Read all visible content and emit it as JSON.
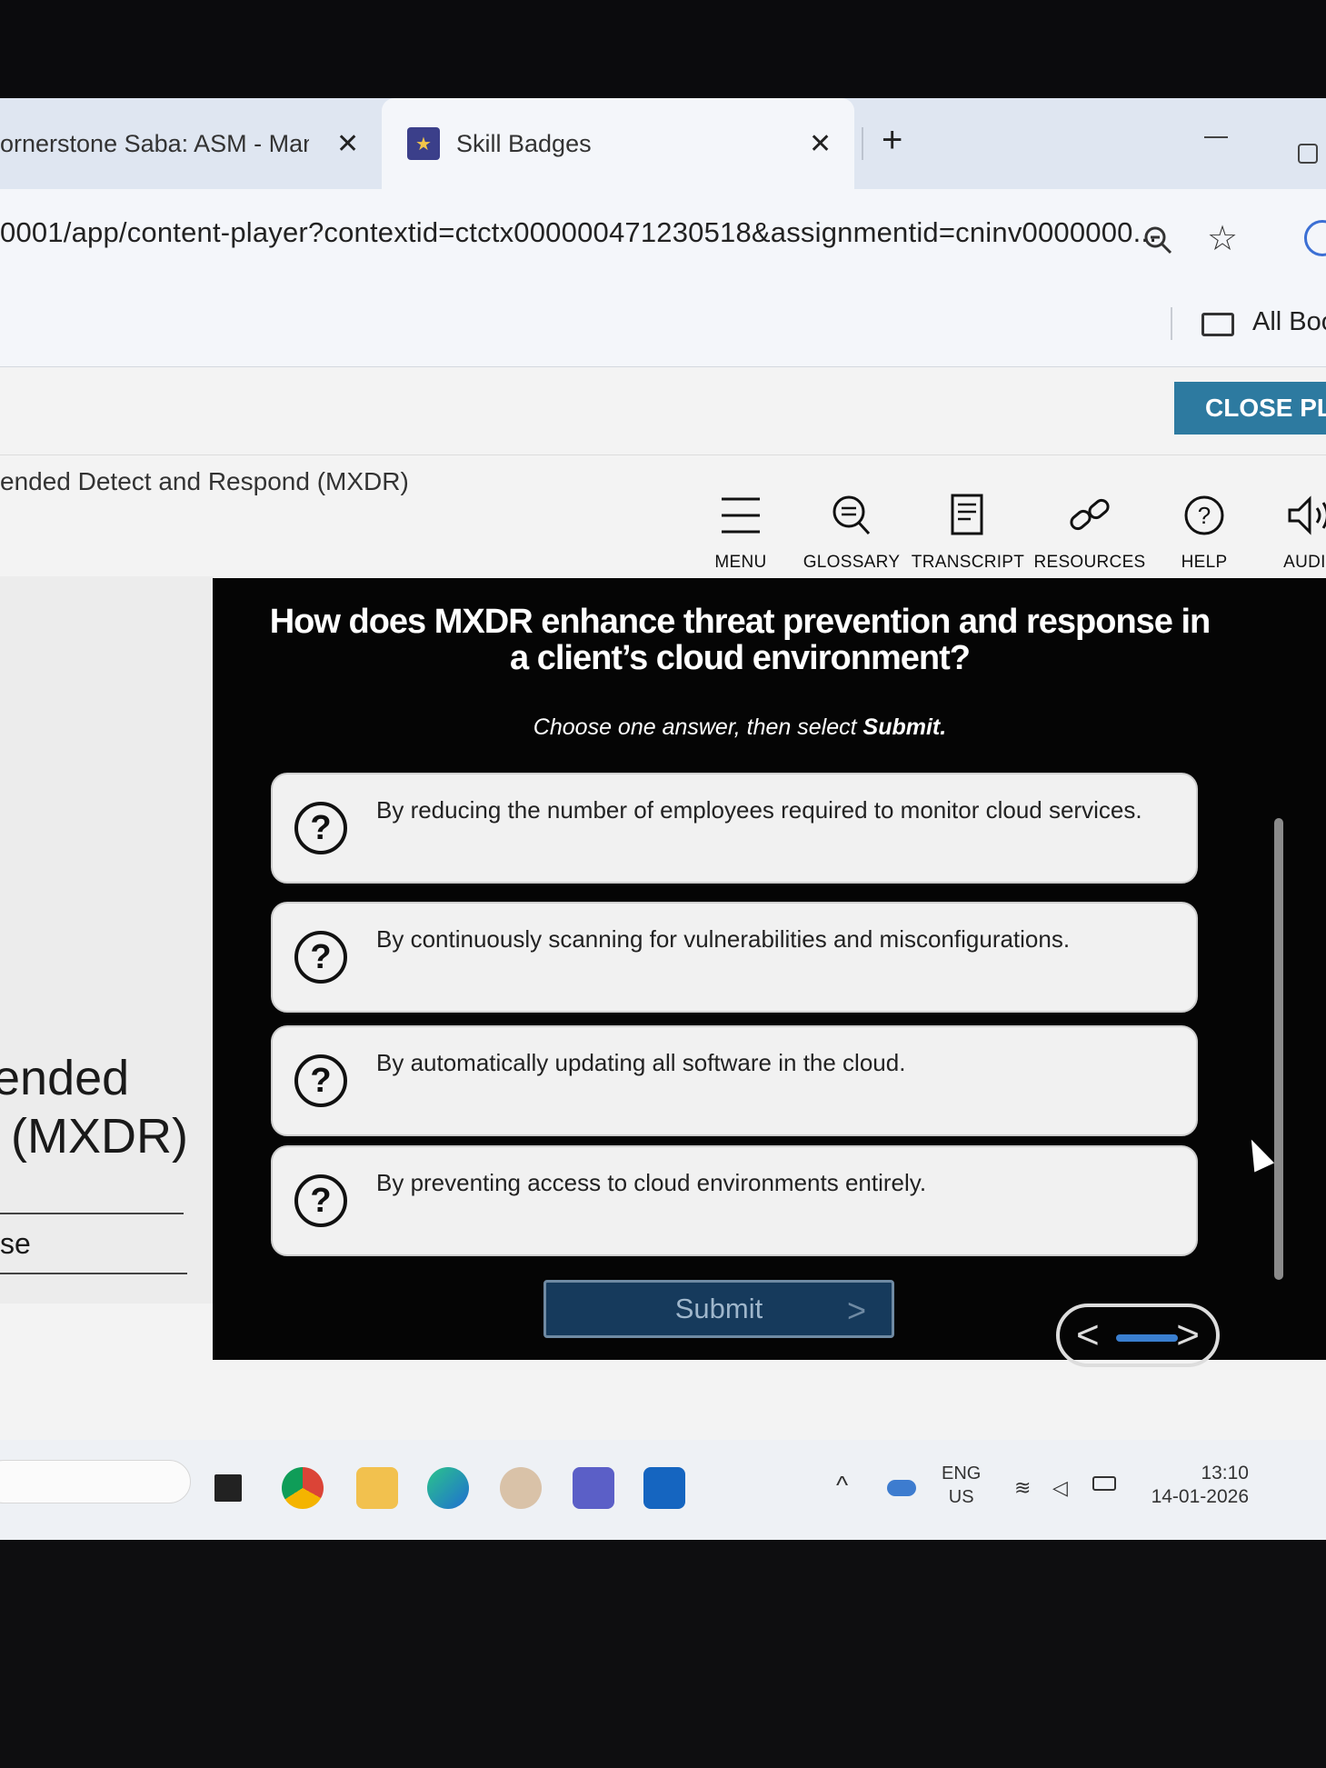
{
  "browser": {
    "tabs": [
      {
        "title": "ornerstone Saba: ASM - Mana"
      },
      {
        "title": "Skill Badges"
      }
    ],
    "new_tab_label": "+",
    "close_glyph": "✕",
    "url": "0001/app/content-player?contextid=ctctx000000471230518&assignmentid=cninv0000000...",
    "bookmarks_label": "All Boo"
  },
  "player": {
    "close_button": "CLOSE PLA",
    "course_title": "ended Detect and Respond (MXDR)",
    "toolbar": [
      {
        "label": "MENU",
        "icon": "menu-icon"
      },
      {
        "label": "GLOSSARY",
        "icon": "glossary-icon"
      },
      {
        "label": "TRANSCRIPT",
        "icon": "transcript-icon"
      },
      {
        "label": "RESOURCES",
        "icon": "resources-icon"
      },
      {
        "label": "HELP",
        "icon": "help-icon"
      },
      {
        "label": "AUDIO",
        "icon": "audio-icon"
      }
    ],
    "sidebar": {
      "title_line1": "ended",
      "title_line2": "(MXDR)",
      "item": "se"
    }
  },
  "quiz": {
    "question": "How does MXDR enhance threat prevention and response in a client’s cloud environment?",
    "instruction_prefix": "Choose one answer, then select ",
    "instruction_action": "Submit.",
    "options": [
      "By reducing the number of employees required to monitor cloud services.",
      "By continuously scanning for vulnerabilities and misconfigurations.",
      "By automatically updating all software in the cloud.",
      "By preventing access to cloud environments entirely."
    ],
    "option_icon_glyph": "?",
    "submit_label": "Submit",
    "colors": {
      "panel": "#050505",
      "submit": "#163a5c",
      "accent": "#2d7aa0"
    }
  },
  "taskbar": {
    "lang_line1": "ENG",
    "lang_line2": "US",
    "time": "13:10",
    "date": "14-01-2026"
  }
}
